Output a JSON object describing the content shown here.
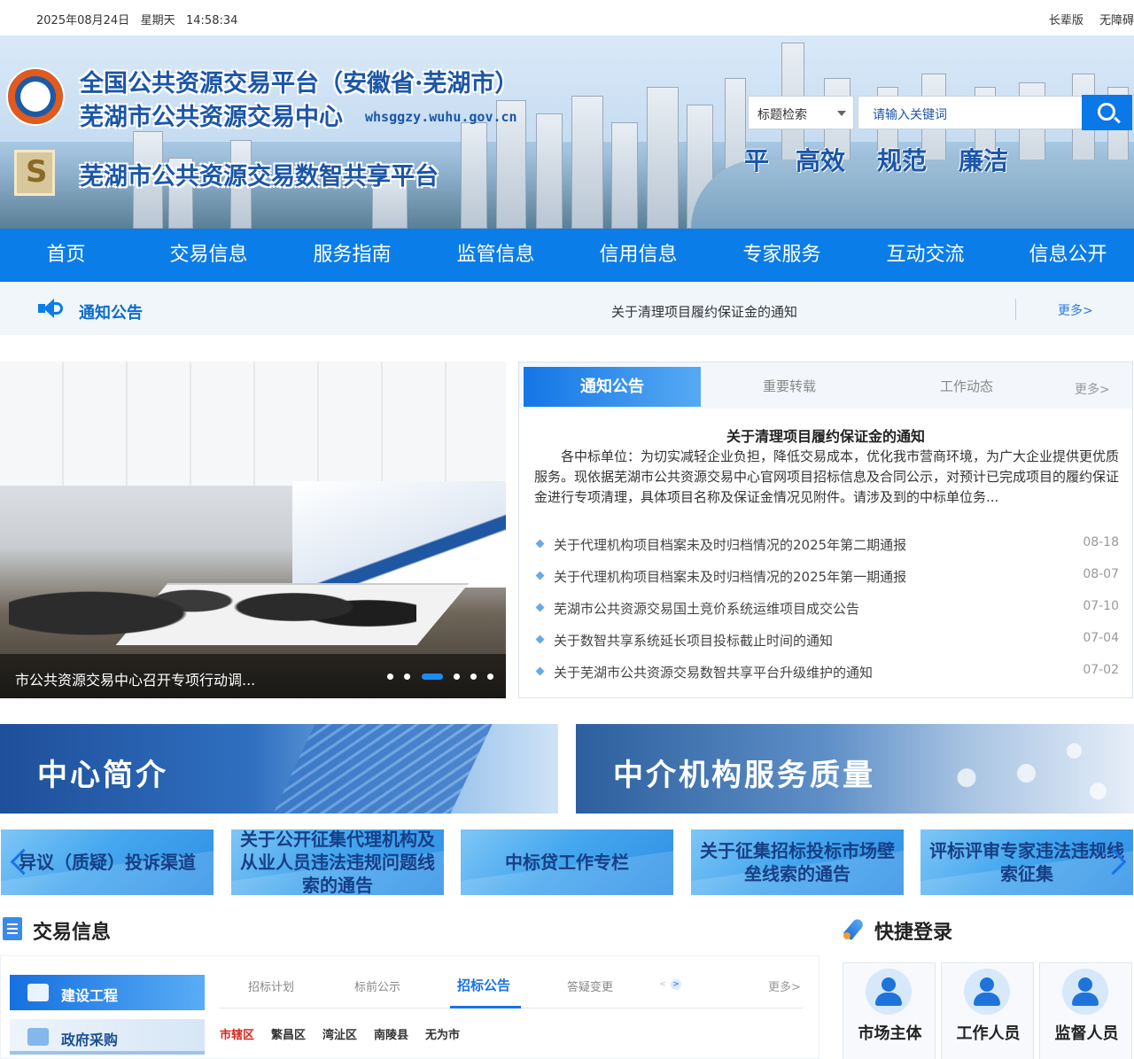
{
  "topbar": {
    "date": "2025年08月24日",
    "weekday": "星期天",
    "time": "14:58:34",
    "elderly": "长辈版",
    "accessible": "无障碍"
  },
  "banner": {
    "title1": "全国公共资源交易平台（安徽省·芜湖市）",
    "title2": "芜湖市公共资源交易中心",
    "url": "whsggzy.wuhu.gov.cn",
    "title3": "芜湖市公共资源交易数智共享平台",
    "slogans": [
      "平",
      "高效",
      "规范",
      "廉洁"
    ],
    "logo2_char": "S"
  },
  "search": {
    "select": "标题检索",
    "placeholder": "请输入关键词"
  },
  "nav": [
    "首页",
    "交易信息",
    "服务指南",
    "监管信息",
    "信用信息",
    "专家服务",
    "互动交流",
    "信息公开"
  ],
  "notice": {
    "label": "通知公告",
    "text": "关于清理项目履约保证金的通知",
    "more": "更多>"
  },
  "slider": {
    "caption": "市公共资源交易中心召开专项行动调...",
    "dots": 6,
    "active_dot": 3
  },
  "news": {
    "tabs": [
      "通知公告",
      "重要转载",
      "工作动态"
    ],
    "more": "更多>",
    "headline": "关于清理项目履约保证金的通知",
    "summary": "各中标单位：为切实减轻企业负担，降低交易成本，优化我市营商环境，为广大企业提供更优质服务。现依据芜湖市公共资源交易中心官网项目招标信息及合同公示，对预计已完成项目的履约保证金进行专项清理，具体项目名称及保证金情况见附件。请涉及到的中标单位务...",
    "items": [
      {
        "title": "关于代理机构项目档案未及时归档情况的2025年第二期通报",
        "date": "08-18"
      },
      {
        "title": "关于代理机构项目档案未及时归档情况的2025年第一期通报",
        "date": "08-07"
      },
      {
        "title": "芜湖市公共资源交易国土竞价系统运维项目成交公告",
        "date": "07-10"
      },
      {
        "title": "关于数智共享系统延长项目投标截止时间的通知",
        "date": "07-04"
      },
      {
        "title": "关于芜湖市公共资源交易数智共享平台升级维护的通知",
        "date": "07-02"
      }
    ]
  },
  "cards": {
    "intro": "中心简介",
    "agency": "中介机构服务质量"
  },
  "carousel": [
    "异议（质疑）投诉渠道",
    "关于公开征集代理机构及从业人员违法违规问题线索的通告",
    "中标贷工作专栏",
    "关于征集招标投标市场壁垒线索的通告",
    "评标评审专家违法违规线索征集"
  ],
  "trade": {
    "title": "交易信息",
    "side": [
      "建设工程",
      "政府采购"
    ],
    "tabs": [
      "招标计划",
      "标前公示",
      "招标公告",
      "答疑变更"
    ],
    "active_tab": "招标公告",
    "nav_prev": "<",
    "nav_next": ">",
    "more": "更多>",
    "regions": [
      "市辖区",
      "繁昌区",
      "湾沚区",
      "南陵县",
      "无为市"
    ]
  },
  "quick": {
    "title": "快捷登录",
    "items": [
      "市场主体",
      "工作人员",
      "监督人员"
    ]
  },
  "colors": {
    "nav_blue": "#0b7de8",
    "title_blue": "#1b56a8",
    "region_active": "#d6261b"
  }
}
